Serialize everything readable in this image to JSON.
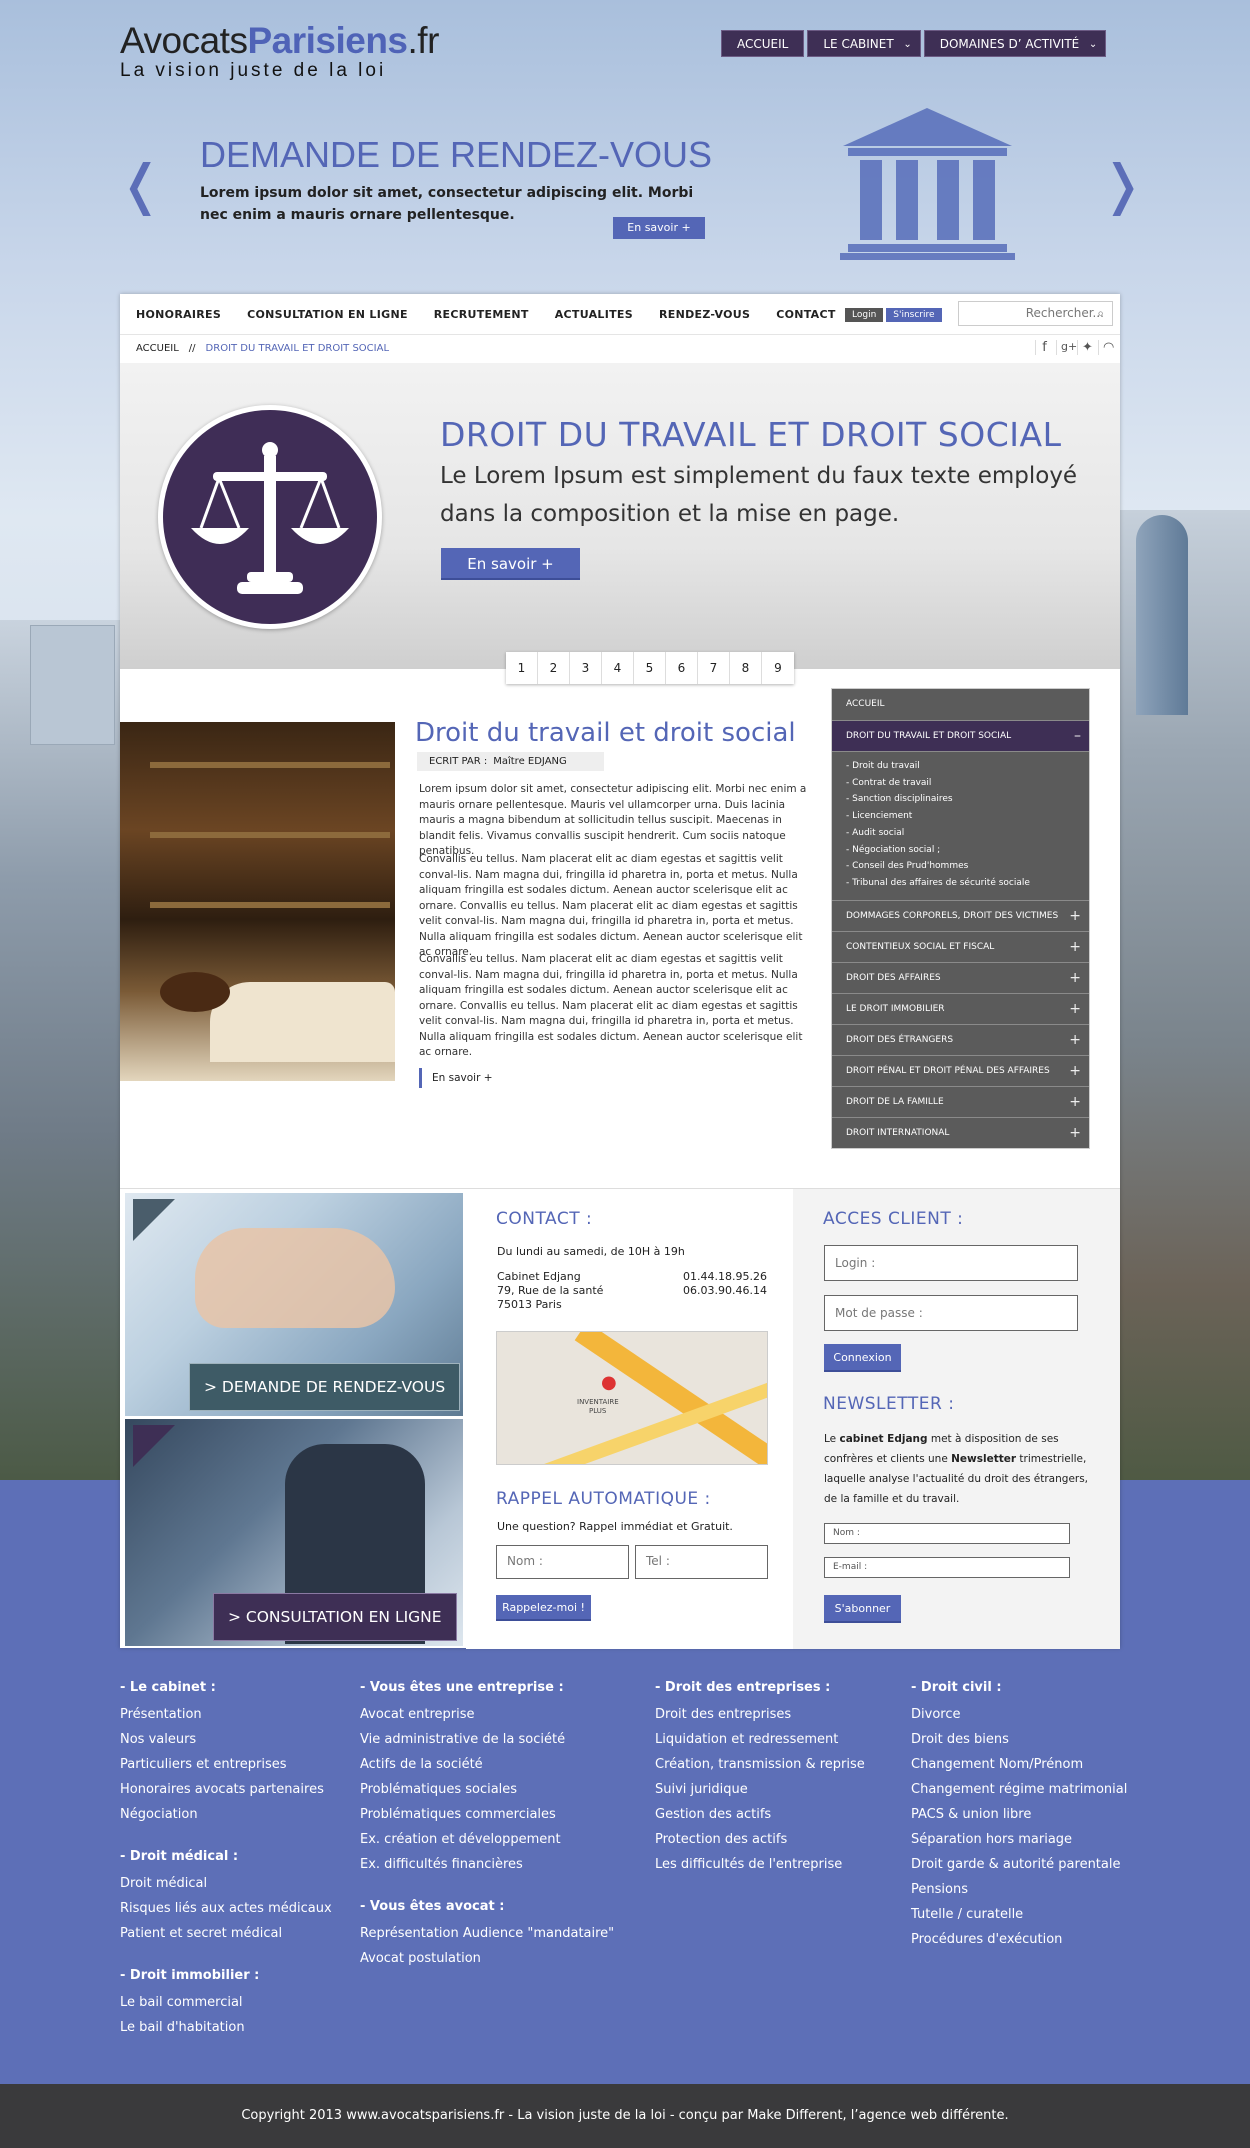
{
  "header": {
    "logo_part1": "Avocats",
    "logo_part2": "Parisiens",
    "logo_part3": ".fr",
    "tagline": "La vision juste de la loi",
    "nav": [
      "ACCUEIL",
      "LE CABINET",
      "DOMAINES D’ ACTIVITÉ"
    ]
  },
  "hero": {
    "title": "DEMANDE DE RENDEZ-VOUS",
    "text": "Lorem ipsum dolor sit amet, consectetur adipiscing elit. Morbi nec enim a mauris ornare pellentesque.",
    "button": "En savoir +",
    "arrow_left": "❬",
    "arrow_right": "❭"
  },
  "mainnav": {
    "items": [
      "HONORAIRES",
      "CONSULTATION EN LIGNE",
      "RECRUTEMENT",
      "ACTUALITES",
      "RENDEZ-VOUS",
      "CONTACT"
    ],
    "login": "Login",
    "signup": "S'inscrire",
    "search_placeholder": "Rechercher..."
  },
  "breadcrumb": {
    "home": "ACCUEIL",
    "separator": "//",
    "current": "DROIT DU TRAVAIL ET DROIT SOCIAL"
  },
  "social_icons": [
    "facebook-icon",
    "google-plus-icon",
    "twitter-icon",
    "rss-icon"
  ],
  "banner": {
    "title": "DROIT DU TRAVAIL ET DROIT SOCIAL",
    "text": "Le Lorem Ipsum est simplement du faux texte employé dans la composition et la mise en page.",
    "button": "En savoir +",
    "pages": [
      "1",
      "2",
      "3",
      "4",
      "5",
      "6",
      "7",
      "8",
      "9"
    ]
  },
  "article": {
    "title": "Droit du travail et droit social",
    "author_label": "ECRIT PAR  :",
    "author": "Maître EDJANG",
    "paragraphs": [
      "Lorem ipsum dolor sit amet, consectetur adipiscing elit. Morbi nec enim a mauris ornare pellentesque. Mauris vel ullamcorper urna. Duis lacinia mauris a magna bibendum at sollicitudin tellus suscipit. Maecenas in blandit felis. Vivamus convallis suscipit hendrerit. Cum sociis natoque penatibus.",
      "Convallis eu tellus. Nam placerat elit ac diam egestas et sagittis velit conval-lis. Nam magna dui, fringilla id pharetra in, porta et metus. Nulla aliquam fringilla est sodales dictum. Aenean auctor scelerisque elit ac ornare. Convallis eu tellus. Nam placerat elit ac diam egestas et sagittis velit conval-lis. Nam magna dui, fringilla id pharetra in, porta et metus. Nulla aliquam fringilla est sodales dictum. Aenean auctor scelerisque elit ac ornare.",
      "Convallis eu tellus. Nam placerat elit ac diam egestas et sagittis velit conval-lis. Nam magna dui, fringilla id pharetra in, porta et metus. Nulla aliquam fringilla est sodales dictum. Aenean auctor scelerisque elit ac ornare. Convallis eu tellus. Nam placerat elit ac diam egestas et sagittis velit conval-lis. Nam magna dui, fringilla id pharetra in, porta et metus. Nulla aliquam fringilla est sodales dictum. Aenean auctor scelerisque elit ac ornare."
    ],
    "more": "En savoir +"
  },
  "sidebar": {
    "home": "ACCUEIL",
    "active": "DROIT DU TRAVAIL ET DROIT SOCIAL",
    "active_toggle": "–",
    "sub_items": [
      "- Droit du travail",
      "- Contrat de travail",
      "- Sanction disciplinaires",
      "- Licenciement",
      "- Audit social",
      "- Négociation social ;",
      "- Conseil des Prud'hommes",
      "- Tribunal des affaires de sécurité sociale"
    ],
    "items": [
      "DOMMAGES CORPORELS, DROIT DES VICTIMES",
      "CONTENTIEUX SOCIAL ET FISCAL",
      "DROIT DES AFFAIRES",
      "LE DROIT IMMOBILIER",
      "DROIT DES ÉTRANGERS",
      "DROIT PÉNAL ET DROIT PÉNAL DES AFFAIRES",
      "DROIT DE LA FAMILLE",
      "DROIT INTERNATIONAL"
    ],
    "plus": "+"
  },
  "promos": {
    "rdv": "> DEMANDE DE RENDEZ-VOUS",
    "consult": "> CONSULTATION EN LIGNE"
  },
  "contact": {
    "title": "CONTACT :",
    "hours": "Du lundi au samedi, de 10H à 19h",
    "name": "Cabinet Edjang",
    "street": "79, Rue de la santé",
    "city": "75013 Paris",
    "phone1": "01.44.18.95.26",
    "phone2": "06.03.90.46.14",
    "map_label1": "INVENTAIRE",
    "map_label2": "PLUS"
  },
  "rappel": {
    "title": "RAPPEL AUTOMATIQUE :",
    "text": "Une question? Rappel immédiat et Gratuit.",
    "name_placeholder": "Nom :",
    "tel_placeholder": "Tel :",
    "button": "Rappelez-moi !"
  },
  "acces": {
    "title": "ACCES CLIENT :",
    "login_placeholder": "Login :",
    "password_placeholder": "Mot de passe :",
    "button": "Connexion"
  },
  "newsletter": {
    "title": "NEWSLETTER :",
    "t1": "Le ",
    "t2": "cabinet Edjang",
    "t3": " met à disposition de ses confrères et clients une ",
    "t4": "Newsletter",
    "t5": " trimestrielle, laquelle analyse l'actualité du droit des étrangers, de la famille et du travail.",
    "name_placeholder": "Nom :",
    "email_placeholder": "E-mail :",
    "button": "S'abonner"
  },
  "footer": {
    "col1": [
      {
        "heading": "- Le cabinet :",
        "links": [
          "Présentation",
          "Nos valeurs",
          "Particuliers et entreprises",
          "Honoraires avocats partenaires",
          "Négociation"
        ]
      },
      {
        "heading": "- Droit médical :",
        "links": [
          "Droit médical",
          "Risques liés aux actes médicaux",
          "Patient et secret médical"
        ]
      },
      {
        "heading": "- Droit immobilier :",
        "links": [
          "Le bail commercial",
          "Le bail d'habitation"
        ]
      }
    ],
    "col2": [
      {
        "heading": "- Vous êtes une entreprise :",
        "links": [
          "Avocat entreprise",
          "Vie administrative de la société",
          "Actifs de la société",
          "Problématiques sociales",
          "Problématiques commerciales",
          "Ex. création et développement",
          "Ex. difficultés financières"
        ]
      },
      {
        "heading": "- Vous êtes avocat :",
        "links": [
          "Représentation Audience \"mandataire\"",
          "Avocat postulation"
        ]
      }
    ],
    "col3": [
      {
        "heading": "- Droit des entreprises :",
        "links": [
          "Droit des entreprises",
          "Liquidation et redressement",
          "Création, transmission & reprise",
          "Suivi juridique",
          "Gestion des actifs",
          "Protection des actifs",
          "Les difficultés de l'entreprise"
        ]
      }
    ],
    "col4": [
      {
        "heading": "- Droit civil :",
        "links": [
          "Divorce",
          "Droit des biens",
          "Changement Nom/Prénom",
          "Changement régime matrimonial",
          "PACS & union libre",
          "Séparation hors mariage",
          "Droit garde & autorité parentale",
          "Pensions",
          "Tutelle / curatelle",
          "Procédures d'exécution"
        ]
      }
    ],
    "copyright": "Copyright 2013 www.avocatsparisiens.fr - La vision juste de la loi - conçu par Make Different, l’agence web différente."
  },
  "colors": {
    "accent": "#5466b6",
    "purple": "#3e2f55",
    "sidebar_bg": "#5b5b5b",
    "footer_bg": "#5d6fb7",
    "copyright_bg": "#3a3a3c"
  }
}
